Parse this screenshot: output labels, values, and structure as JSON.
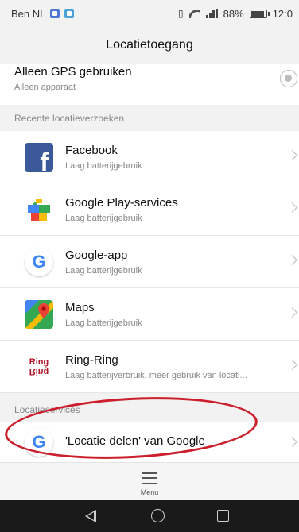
{
  "status_bar": {
    "carrier": "Ben NL",
    "battery_percent": "88%",
    "battery_level": 0.88,
    "time": "12:0",
    "icons": [
      "notification-icon",
      "image-icon",
      "vibrate-icon",
      "wifi-icon",
      "signal-icon",
      "battery-icon"
    ]
  },
  "header": {
    "title": "Locatietoegang"
  },
  "gps_option": {
    "title": "Alleen GPS gebruiken",
    "subtitle": "Alleen apparaat"
  },
  "recent_section": {
    "title": "Recente locatieverzoeken",
    "items": [
      {
        "name": "Facebook",
        "detail": "Laag batterijgebruik",
        "icon": "facebook-icon"
      },
      {
        "name": "Google Play-services",
        "detail": "Laag batterijgebruik",
        "icon": "puzzle-icon"
      },
      {
        "name": "Google-app",
        "detail": "Laag batterijgebruik",
        "icon": "google-icon"
      },
      {
        "name": "Maps",
        "detail": "Laag batterijgebruik",
        "icon": "maps-icon"
      },
      {
        "name": "Ring-Ring",
        "detail": "Laag batterijverbruik, meer gebruik van locati...",
        "icon": "ring-ring-icon",
        "icon_text": "Ring"
      }
    ]
  },
  "services_section": {
    "title": "Locatieservices",
    "items": [
      {
        "name": "'Locatie delen' van Google",
        "icon": "google-icon"
      }
    ]
  },
  "menu": {
    "label": "Menu"
  },
  "colors": {
    "highlight": "#cc1f2d",
    "facebook": "#3b5998",
    "ring": "#b01226"
  }
}
